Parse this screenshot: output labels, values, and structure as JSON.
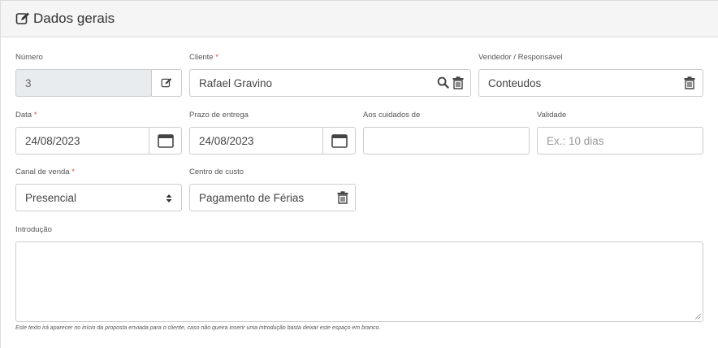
{
  "panel": {
    "title": "Dados gerais",
    "icon": "edit-icon"
  },
  "fields": {
    "numero": {
      "label": "Número",
      "value": "3"
    },
    "cliente": {
      "label": "Cliente",
      "required": "*",
      "value": "Rafael Gravino"
    },
    "vendedor": {
      "label": "Vendedor / Responsável",
      "value": "Conteudos"
    },
    "data": {
      "label": "Data",
      "required": "*",
      "value": "24/08/2023"
    },
    "prazo": {
      "label": "Prazo de entrega",
      "value": "24/08/2023"
    },
    "cuidados": {
      "label": "Aos cuidados de",
      "value": ""
    },
    "validade": {
      "label": "Validade",
      "placeholder": "Ex.: 10 dias"
    },
    "canal": {
      "label": "Canal de venda",
      "required": "*",
      "value": "Presencial"
    },
    "centro": {
      "label": "Centro de custo",
      "value": "Pagamento de Férias"
    },
    "introducao": {
      "label": "Introdução",
      "value": "",
      "help": "Este texto irá aparecer no início da proposta enviada para o cliente, caso não queira inserir uma introdução basta deixar este espaço em branco."
    }
  },
  "colors": {
    "border": "#cccccc",
    "disabled_bg": "#e9ecef",
    "required": "#d9534f",
    "header_bg": "#f5f5f5"
  }
}
